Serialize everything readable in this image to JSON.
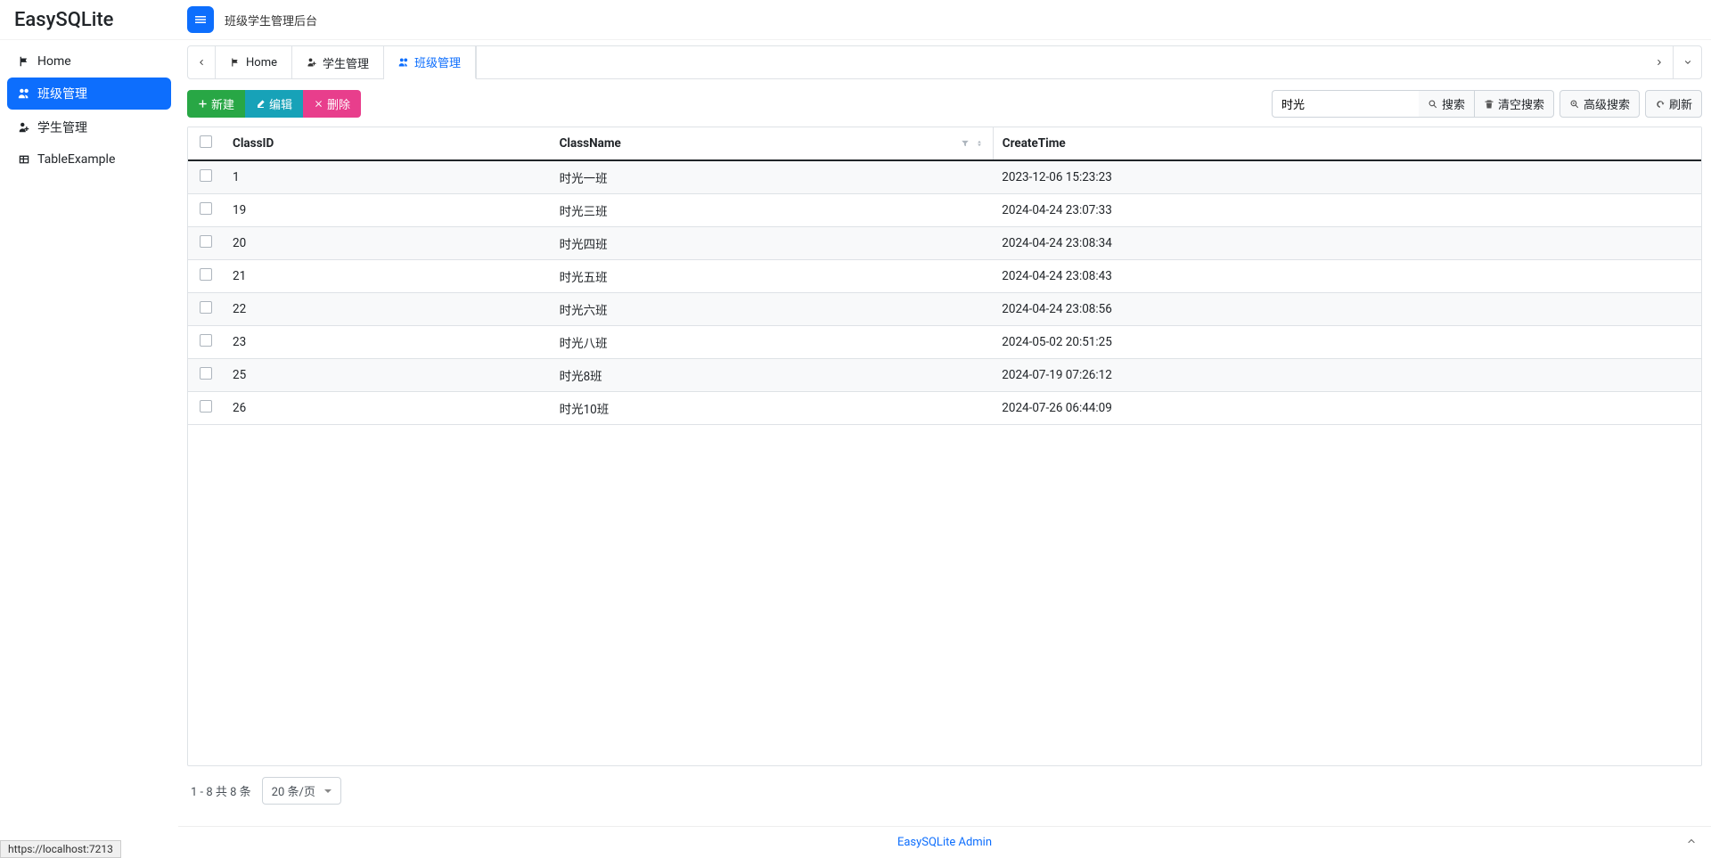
{
  "app": {
    "name": "EasySQLite",
    "header_title": "班级学生管理后台"
  },
  "sidebar": {
    "items": [
      {
        "label": "Home",
        "icon": "flag"
      },
      {
        "label": "班级管理",
        "icon": "users"
      },
      {
        "label": "学生管理",
        "icon": "user-plus"
      },
      {
        "label": "TableExample",
        "icon": "table"
      }
    ]
  },
  "tabs": [
    {
      "label": "Home",
      "icon": "flag"
    },
    {
      "label": "学生管理",
      "icon": "user-plus"
    },
    {
      "label": "班级管理",
      "icon": "users"
    }
  ],
  "toolbar": {
    "new_label": "新建",
    "edit_label": "编辑",
    "delete_label": "删除",
    "search_value": "时光",
    "search_btn": "搜索",
    "clear_btn": "清空搜索",
    "advanced_btn": "高级搜索",
    "refresh_btn": "刷新"
  },
  "table": {
    "columns": {
      "classid": "ClassID",
      "classname": "ClassName",
      "createtime": "CreateTime"
    },
    "rows": [
      {
        "id": "1",
        "name": "时光一班",
        "time": "2023-12-06 15:23:23"
      },
      {
        "id": "19",
        "name": "时光三班",
        "time": "2024-04-24 23:07:33"
      },
      {
        "id": "20",
        "name": "时光四班",
        "time": "2024-04-24 23:08:34"
      },
      {
        "id": "21",
        "name": "时光五班",
        "time": "2024-04-24 23:08:43"
      },
      {
        "id": "22",
        "name": "时光六班",
        "time": "2024-04-24 23:08:56"
      },
      {
        "id": "23",
        "name": "时光八班",
        "time": "2024-05-02 20:51:25"
      },
      {
        "id": "25",
        "name": "时光8班",
        "time": "2024-07-19 07:26:12"
      },
      {
        "id": "26",
        "name": "时光10班",
        "time": "2024-07-26 06:44:09"
      }
    ]
  },
  "pagination": {
    "info": "1 - 8 共 8 条",
    "pagesize": "20 条/页"
  },
  "footer": {
    "link": "EasySQLite Admin"
  },
  "status": {
    "url": "https://localhost:7213"
  }
}
